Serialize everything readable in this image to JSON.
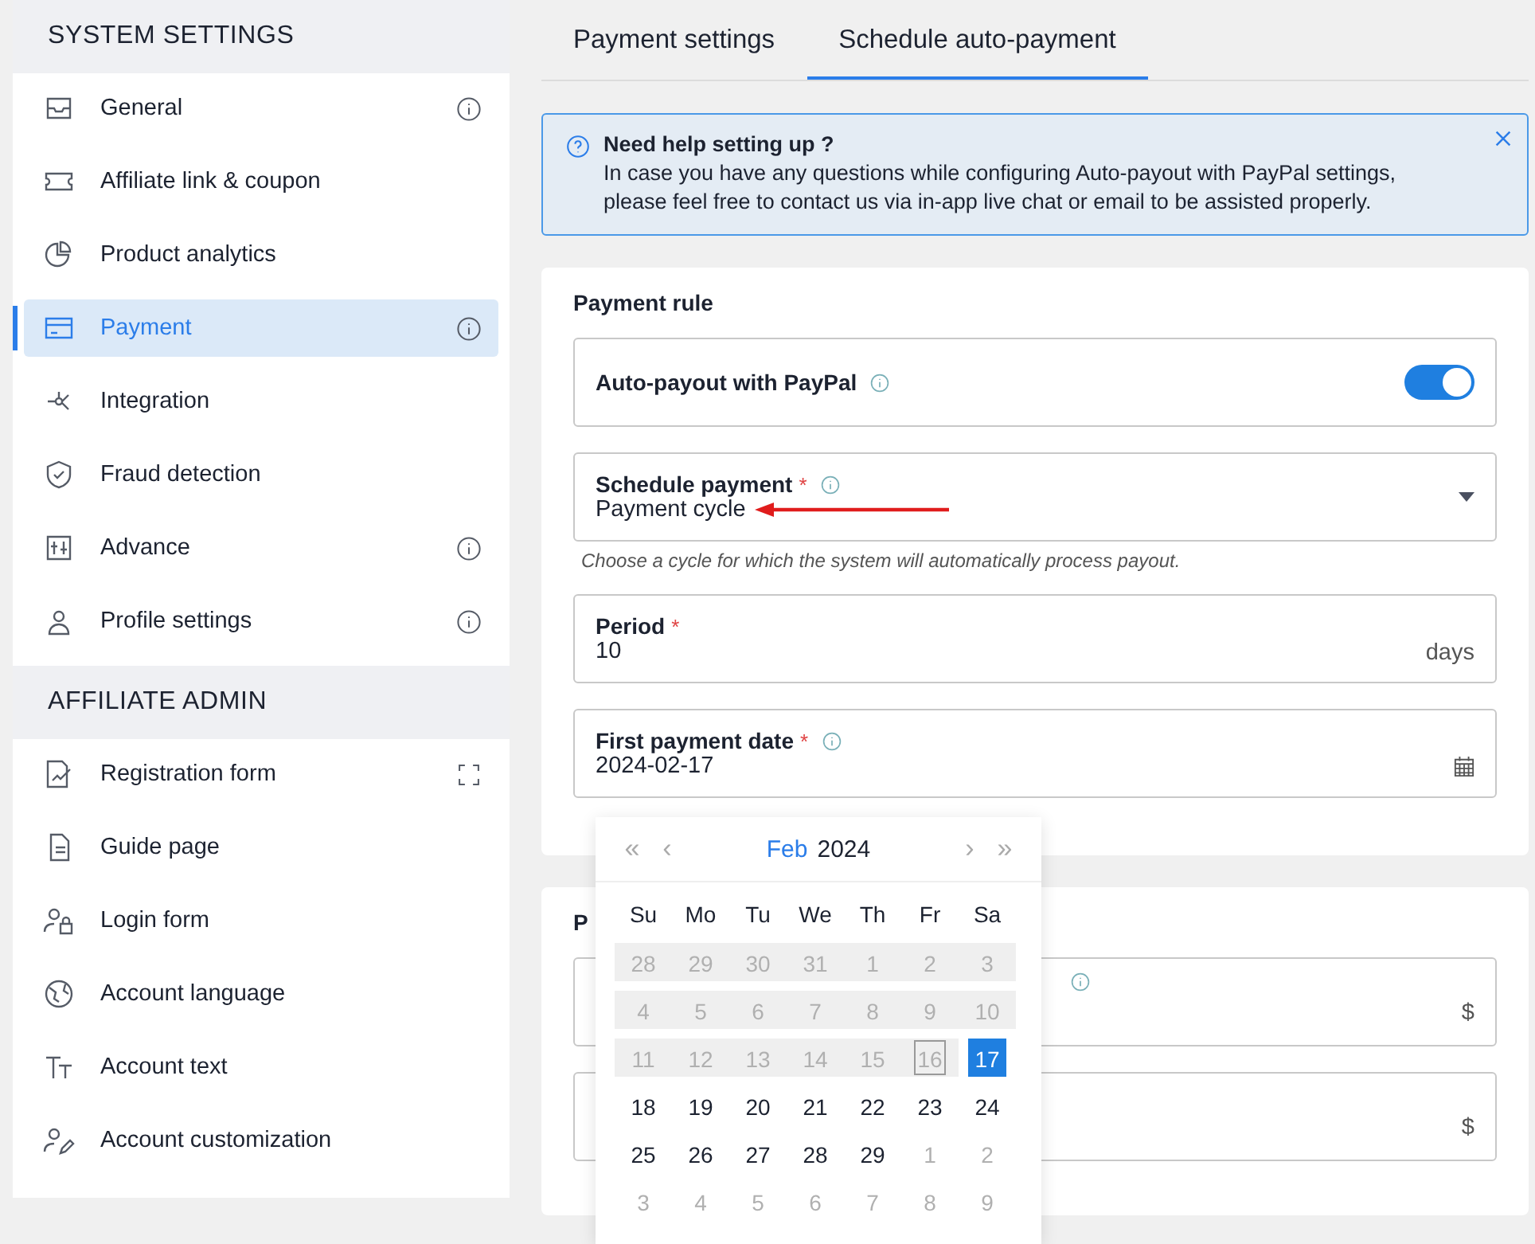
{
  "sidebar": {
    "sections": [
      {
        "title": "SYSTEM SETTINGS",
        "items": [
          {
            "label": "General",
            "selected": false,
            "kind": "info"
          },
          {
            "label": "Affiliate link & coupon",
            "selected": false,
            "kind": "plain"
          },
          {
            "label": "Product analytics",
            "selected": false,
            "kind": "plain"
          },
          {
            "label": "Payment",
            "selected": true,
            "kind": "info"
          },
          {
            "label": "Integration",
            "selected": false,
            "kind": "plain"
          },
          {
            "label": "Fraud detection",
            "selected": false,
            "kind": "plain"
          },
          {
            "label": "Advance",
            "selected": false,
            "kind": "info"
          },
          {
            "label": "Profile settings",
            "selected": false,
            "kind": "info"
          }
        ]
      },
      {
        "title": "AFFILIATE ADMIN",
        "items": [
          {
            "label": "Registration form",
            "selected": false,
            "kind": "expand"
          },
          {
            "label": "Guide page",
            "selected": false,
            "kind": "plain"
          },
          {
            "label": "Login form",
            "selected": false,
            "kind": "plain"
          },
          {
            "label": "Account language",
            "selected": false,
            "kind": "plain"
          },
          {
            "label": "Account text",
            "selected": false,
            "kind": "plain"
          },
          {
            "label": "Account customization",
            "selected": false,
            "kind": "plain"
          }
        ]
      }
    ]
  },
  "tabs": [
    {
      "label": "Payment settings",
      "selected": false
    },
    {
      "label": "Schedule auto-payment",
      "selected": true
    }
  ],
  "help": {
    "title": "Need help setting up ?",
    "text": "In case you have any questions while configuring Auto-payout with PayPal settings, please feel free to contact us via in-app live chat or email to be assisted properly."
  },
  "payment_rule": {
    "title": "Payment rule",
    "toggle": {
      "label": "Auto-payout with PayPal",
      "on": true
    },
    "fields": [
      {
        "kind": "select",
        "label": "Schedule payment",
        "required_mark": "*",
        "info": true,
        "value": "Payment cycle",
        "hint": "Choose a cycle for which the system will automatically process payout."
      },
      {
        "kind": "suffix",
        "label": "Period",
        "required_mark": "*",
        "info": false,
        "value": "10",
        "suffix": "days"
      },
      {
        "kind": "date",
        "label": "First payment date",
        "required_mark": "*",
        "info": true,
        "value": "2024-02-17"
      }
    ]
  },
  "second_card": {
    "title": "P",
    "fields": [
      {
        "info": true,
        "suffix": "$"
      },
      {
        "info": false,
        "suffix": "$"
      }
    ]
  },
  "calendar": {
    "month": "Feb",
    "year": "2024",
    "prev_year": "«",
    "prev_month": "‹",
    "next_month": "›",
    "next_year": "»",
    "weekdays": [
      "Su",
      "Mo",
      "Tu",
      "We",
      "Th",
      "Fr",
      "Sa"
    ],
    "weeks": [
      [
        {
          "label": "28",
          "kind": "disabled",
          "today": false,
          "selected": false
        },
        {
          "label": "29",
          "kind": "disabled",
          "today": false,
          "selected": false
        },
        {
          "label": "30",
          "kind": "disabled",
          "today": false,
          "selected": false
        },
        {
          "label": "31",
          "kind": "disabled",
          "today": false,
          "selected": false
        },
        {
          "label": "1",
          "kind": "disabled",
          "today": false,
          "selected": false
        },
        {
          "label": "2",
          "kind": "disabled",
          "today": false,
          "selected": false
        },
        {
          "label": "3",
          "kind": "disabled",
          "today": false,
          "selected": false
        }
      ],
      [
        {
          "label": "4",
          "kind": "disabled",
          "today": false,
          "selected": false
        },
        {
          "label": "5",
          "kind": "disabled",
          "today": false,
          "selected": false
        },
        {
          "label": "6",
          "kind": "disabled",
          "today": false,
          "selected": false
        },
        {
          "label": "7",
          "kind": "disabled",
          "today": false,
          "selected": false
        },
        {
          "label": "8",
          "kind": "disabled",
          "today": false,
          "selected": false
        },
        {
          "label": "9",
          "kind": "disabled",
          "today": false,
          "selected": false
        },
        {
          "label": "10",
          "kind": "disabled",
          "today": false,
          "selected": false
        }
      ],
      [
        {
          "label": "11",
          "kind": "disabled",
          "today": false,
          "selected": false
        },
        {
          "label": "12",
          "kind": "disabled",
          "today": false,
          "selected": false
        },
        {
          "label": "13",
          "kind": "disabled",
          "today": false,
          "selected": false
        },
        {
          "label": "14",
          "kind": "disabled",
          "today": false,
          "selected": false
        },
        {
          "label": "15",
          "kind": "disabled",
          "today": false,
          "selected": false
        },
        {
          "label": "16",
          "kind": "disabled",
          "today": true,
          "selected": false
        },
        {
          "label": "17",
          "kind": "current",
          "today": false,
          "selected": true
        }
      ],
      [
        {
          "label": "18",
          "kind": "current",
          "today": false,
          "selected": false
        },
        {
          "label": "19",
          "kind": "current",
          "today": false,
          "selected": false
        },
        {
          "label": "20",
          "kind": "current",
          "today": false,
          "selected": false
        },
        {
          "label": "21",
          "kind": "current",
          "today": false,
          "selected": false
        },
        {
          "label": "22",
          "kind": "current",
          "today": false,
          "selected": false
        },
        {
          "label": "23",
          "kind": "current",
          "today": false,
          "selected": false
        },
        {
          "label": "24",
          "kind": "current",
          "today": false,
          "selected": false
        }
      ],
      [
        {
          "label": "25",
          "kind": "current",
          "today": false,
          "selected": false
        },
        {
          "label": "26",
          "kind": "current",
          "today": false,
          "selected": false
        },
        {
          "label": "27",
          "kind": "current",
          "today": false,
          "selected": false
        },
        {
          "label": "28",
          "kind": "current",
          "today": false,
          "selected": false
        },
        {
          "label": "29",
          "kind": "current",
          "today": false,
          "selected": false
        },
        {
          "label": "1",
          "kind": "outside",
          "today": false,
          "selected": false
        },
        {
          "label": "2",
          "kind": "outside",
          "today": false,
          "selected": false
        }
      ],
      [
        {
          "label": "3",
          "kind": "outside",
          "today": false,
          "selected": false
        },
        {
          "label": "4",
          "kind": "outside",
          "today": false,
          "selected": false
        },
        {
          "label": "5",
          "kind": "outside",
          "today": false,
          "selected": false
        },
        {
          "label": "6",
          "kind": "outside",
          "today": false,
          "selected": false
        },
        {
          "label": "7",
          "kind": "outside",
          "today": false,
          "selected": false
        },
        {
          "label": "8",
          "kind": "outside",
          "today": false,
          "selected": false
        },
        {
          "label": "9",
          "kind": "outside",
          "today": false,
          "selected": false
        }
      ]
    ]
  }
}
